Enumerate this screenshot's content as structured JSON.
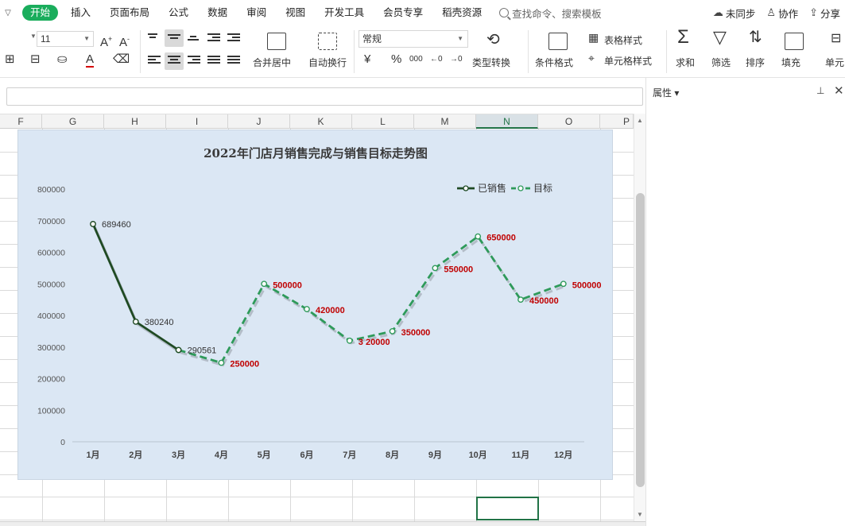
{
  "menubar": {
    "tabs": [
      "开始",
      "插入",
      "页面布局",
      "公式",
      "数据",
      "审阅",
      "视图",
      "开发工具",
      "会员专享",
      "稻壳资源"
    ],
    "active_tab": "开始",
    "search_placeholder": "查找命令、搜索模板",
    "sync_label": "未同步",
    "collab_label": "协作",
    "share_label": "分享"
  },
  "ribbon": {
    "font_size": "11",
    "merge_center": "合并居中",
    "wrap_text": "自动换行",
    "number_format": "常规",
    "currency_symbol": "¥",
    "percent_symbol": "%",
    "thousands": "000",
    "type_convert": "类型转换",
    "conditional_format": "条件格式",
    "table_style": "表格样式",
    "cell_style": "单元格样式",
    "sum": "求和",
    "filter": "筛选",
    "sort": "排序",
    "fill": "填充",
    "cell": "单元"
  },
  "sheet": {
    "columns": [
      "F",
      "G",
      "H",
      "I",
      "J",
      "K",
      "L",
      "M",
      "N",
      "O",
      "P"
    ],
    "selected_column": "N"
  },
  "side_panel": {
    "title": "属性"
  },
  "chart_data": {
    "type": "line",
    "title": "2022年门店月销售完成与销售目标走势图",
    "categories": [
      "1月",
      "2月",
      "3月",
      "4月",
      "5月",
      "6月",
      "7月",
      "8月",
      "9月",
      "10月",
      "11月",
      "12月"
    ],
    "series": [
      {
        "name": "已销售",
        "values": [
          689460,
          380240,
          290561,
          null,
          null,
          null,
          null,
          null,
          null,
          null,
          null,
          null
        ],
        "color": "#1f4a23"
      },
      {
        "name": "目标",
        "values": [
          null,
          null,
          290561,
          250000,
          500000,
          420000,
          320000,
          350000,
          550000,
          650000,
          450000,
          500000
        ],
        "color": "#2e9a5a"
      }
    ],
    "data_labels_sold": [
      "689460",
      "380240",
      "290561"
    ],
    "data_labels_target": [
      "250000",
      "500000",
      "420000",
      "3 20000",
      "350000",
      "550000",
      "650000",
      "450000",
      "500000"
    ],
    "y_ticks": [
      "0",
      "100000",
      "200000",
      "300000",
      "400000",
      "500000",
      "600000",
      "700000",
      "800000"
    ],
    "ylim": [
      0,
      800000
    ],
    "legend": "top-right",
    "grid": false,
    "background": "#dbe7f4",
    "target_label_color": "#c00000"
  }
}
